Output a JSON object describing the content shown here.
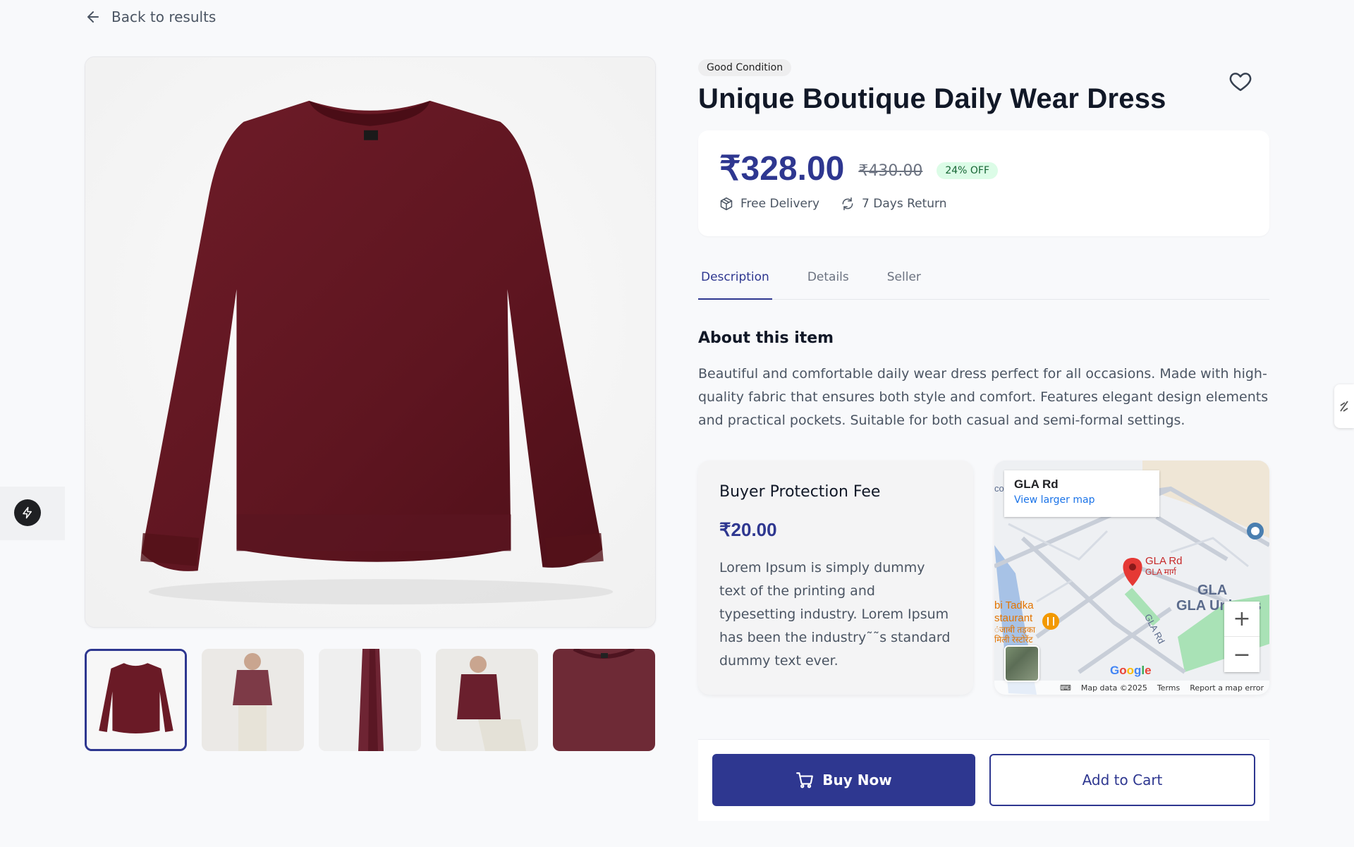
{
  "nav": {
    "back_label": "Back to results"
  },
  "product": {
    "condition": "Good Condition",
    "title": "Unique Boutique Daily Wear Dress",
    "price": "₹328.00",
    "old_price": "₹430.00",
    "discount": "24% OFF",
    "perks": [
      "Free Delivery",
      "7 Days Return"
    ]
  },
  "tabs": [
    "Description",
    "Details",
    "Seller"
  ],
  "description": {
    "heading": "About this item",
    "text": "Beautiful and comfortable daily wear dress perfect for all occasions. Made with high-quality fabric that ensures both style and comfort. Features elegant design elements and practical pockets. Suitable for both casual and semi-formal settings."
  },
  "fee": {
    "title": "Buyer Protection Fee",
    "amount": "₹20.00",
    "text": "Lorem Ipsum is simply dummy text of the printing and typesetting industry. Lorem Ipsum has been the industry˜˜s standard dummy text ever."
  },
  "map": {
    "place": "GLA Rd",
    "larger_map": "View larger map",
    "pin_label": "GLA Rd",
    "pin_label_hindi": "GLA मार्ग",
    "univ_label": "GLA Univers",
    "univ_label_top": "GLA",
    "restaurant_label_1": "bi Tadka",
    "restaurant_label_2": "staurant",
    "restaurant_label_3": "ंजाबी तड़का",
    "restaurant_label_4": "मिली रेस्टोरेंट",
    "road_label": "GLA Rd",
    "edge_label": "co",
    "google": "Google",
    "footer": [
      "Map data ©2025",
      "Terms",
      "Report a map error"
    ],
    "zoom_in": "+",
    "zoom_out": "−"
  },
  "actions": {
    "buy_now": "Buy Now",
    "add_to_cart": "Add to Cart"
  },
  "colors": {
    "brand": "#2e3790",
    "sweater": "#6a1a26",
    "discount_bg": "#dcfce7"
  }
}
